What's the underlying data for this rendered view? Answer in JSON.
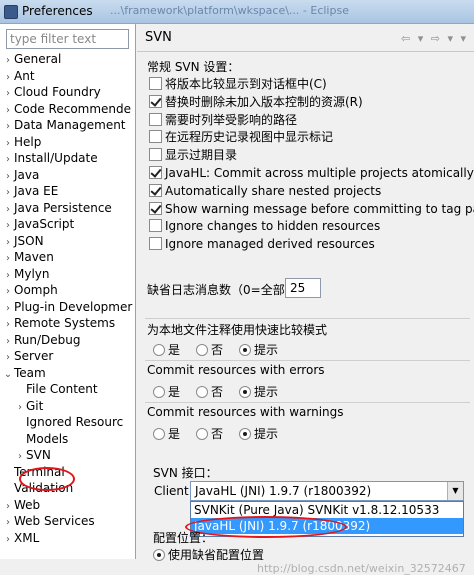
{
  "window": {
    "title": "Preferences",
    "faded_path": "...\\framework\\platform\\wkspace\\... - Eclipse"
  },
  "left": {
    "filter_placeholder": "type filter text",
    "tree": [
      {
        "label": "General",
        "expand": "›",
        "level": 0
      },
      {
        "label": "Ant",
        "expand": "›",
        "level": 0
      },
      {
        "label": "Cloud Foundry",
        "expand": "›",
        "level": 0
      },
      {
        "label": "Code Recommende",
        "expand": "›",
        "level": 0
      },
      {
        "label": "Data Management",
        "expand": "›",
        "level": 0
      },
      {
        "label": "Help",
        "expand": "›",
        "level": 0
      },
      {
        "label": "Install/Update",
        "expand": "›",
        "level": 0
      },
      {
        "label": "Java",
        "expand": "›",
        "level": 0
      },
      {
        "label": "Java EE",
        "expand": "›",
        "level": 0
      },
      {
        "label": "Java Persistence",
        "expand": "›",
        "level": 0
      },
      {
        "label": "JavaScript",
        "expand": "›",
        "level": 0
      },
      {
        "label": "JSON",
        "expand": "›",
        "level": 0
      },
      {
        "label": "Maven",
        "expand": "›",
        "level": 0
      },
      {
        "label": "Mylyn",
        "expand": "›",
        "level": 0
      },
      {
        "label": "Oomph",
        "expand": "›",
        "level": 0
      },
      {
        "label": "Plug-in Developmer",
        "expand": "›",
        "level": 0
      },
      {
        "label": "Remote Systems",
        "expand": "›",
        "level": 0
      },
      {
        "label": "Run/Debug",
        "expand": "›",
        "level": 0
      },
      {
        "label": "Server",
        "expand": "›",
        "level": 0
      },
      {
        "label": "Team",
        "expand": "⌄",
        "level": 0
      },
      {
        "label": "File Content",
        "expand": "",
        "level": 1
      },
      {
        "label": "Git",
        "expand": "›",
        "level": 1
      },
      {
        "label": "Ignored Resourc",
        "expand": "",
        "level": 1
      },
      {
        "label": "Models",
        "expand": "",
        "level": 1
      },
      {
        "label": "SVN",
        "expand": "›",
        "level": 1
      },
      {
        "label": "Terminal",
        "expand": "",
        "level": 0
      },
      {
        "label": "Validation",
        "expand": "",
        "level": 0
      },
      {
        "label": "Web",
        "expand": "›",
        "level": 0
      },
      {
        "label": "Web Services",
        "expand": "›",
        "level": 0
      },
      {
        "label": "XML",
        "expand": "›",
        "level": 0
      }
    ]
  },
  "right": {
    "title": "SVN",
    "nav_arrows": "⇦ ▾ ⇨ ▾ ▾",
    "general_title": "常规 SVN 设置：",
    "checkboxes": [
      {
        "label": "将版本比较显示到对话框中(C)",
        "checked": false
      },
      {
        "label": "替换时删除未加入版本控制的资源(R)",
        "checked": true
      },
      {
        "label": "需要时列举受影响的路径",
        "checked": false
      },
      {
        "label": "在远程历史记录视图中显示标记",
        "checked": false
      },
      {
        "label": "显示过期目录",
        "checked": false
      },
      {
        "label": "JavaHL: Commit across multiple projects atomically",
        "checked": true
      },
      {
        "label": "Automatically share nested projects",
        "checked": true
      },
      {
        "label": "Show warning message before committing to tag path",
        "checked": true
      },
      {
        "label": "Ignore changes to hidden resources",
        "checked": false
      },
      {
        "label": "Ignore managed derived resources",
        "checked": false
      }
    ],
    "log_label": "缺省日志消息数（0=全部）",
    "log_value": "25",
    "groups": [
      {
        "title": "为本地文件注释使用快速比较模式",
        "options": [
          "是",
          "否",
          "提示"
        ],
        "selected": 2
      },
      {
        "title": "Commit resources with errors",
        "options": [
          "是",
          "否",
          "提示"
        ],
        "selected": 2
      },
      {
        "title": "Commit resources with warnings",
        "options": [
          "是",
          "否",
          "提示"
        ],
        "selected": 2
      }
    ],
    "svn_interface_title": "SVN 接口：",
    "client_label": "Client:",
    "client_value": "JavaHL (JNI) 1.9.7 (r1800392)",
    "client_options": [
      "SVNKit (Pure Java) SVNKit v1.8.12.10533",
      "JavaHL (JNI) 1.9.7 (r1800392)"
    ],
    "config_title": "配置位置：",
    "config_default": "使用缺省配置位置",
    "watermark": "http://blog.csdn.net/weixin_32572467"
  }
}
